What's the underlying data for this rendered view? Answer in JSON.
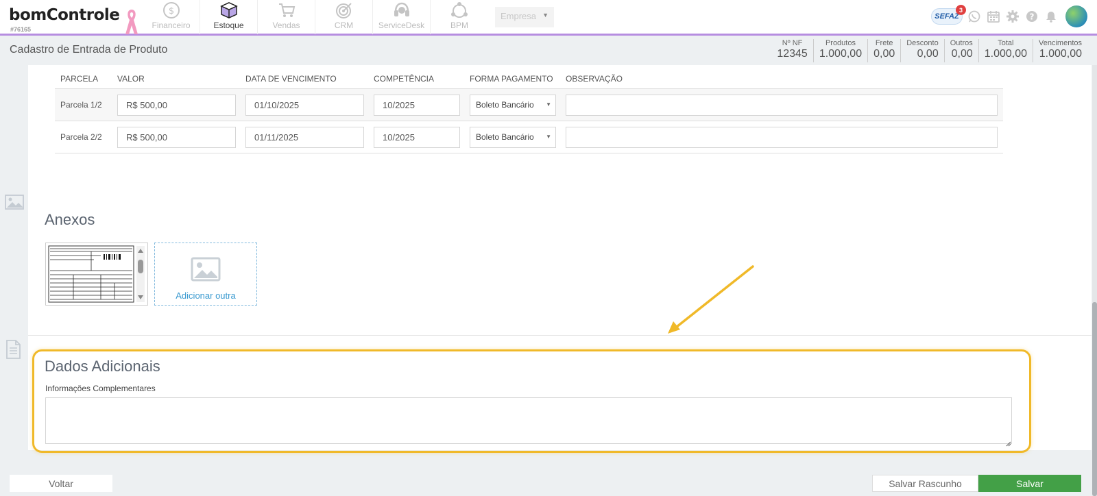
{
  "app": {
    "logo_text": "bomControle",
    "account_id": "#76165"
  },
  "modules": [
    {
      "label": "Financeiro",
      "icon": "dollar-coin-icon",
      "active": false
    },
    {
      "label": "Estoque",
      "icon": "box-icon",
      "active": true
    },
    {
      "label": "Vendas",
      "icon": "shopping-cart-icon",
      "active": false
    },
    {
      "label": "CRM",
      "icon": "target-icon",
      "active": false
    },
    {
      "label": "ServiceDesk",
      "icon": "headset-icon",
      "active": false
    },
    {
      "label": "BPM",
      "icon": "process-cycle-icon",
      "active": false
    }
  ],
  "company_select": {
    "value": "Empresa"
  },
  "header_right": {
    "sefaz_label": "SEFAZ",
    "sefaz_badge": "3"
  },
  "page": {
    "title": "Cadastro de Entrada de Produto"
  },
  "totals": [
    {
      "label": "Nº NF",
      "value": "12345"
    },
    {
      "label": "Produtos",
      "value": "1.000,00"
    },
    {
      "label": "Frete",
      "value": "0,00"
    },
    {
      "label": "Desconto",
      "value": "0,00"
    },
    {
      "label": "Outros",
      "value": "0,00"
    },
    {
      "label": "Total",
      "value": "1.000,00"
    },
    {
      "label": "Vencimentos",
      "value": "1.000,00"
    }
  ],
  "installments": {
    "headers": {
      "parcela": "PARCELA",
      "valor": "VALOR",
      "data": "DATA DE VENCIMENTO",
      "competencia": "COMPETÊNCIA",
      "forma": "FORMA PAGAMENTO",
      "obs": "OBSERVAÇÃO"
    },
    "rows": [
      {
        "parcela": "Parcela 1/2",
        "valor": "R$ 500,00",
        "data": "01/10/2025",
        "competencia": "10/2025",
        "forma": "Boleto Bancário",
        "obs": ""
      },
      {
        "parcela": "Parcela 2/2",
        "valor": "R$ 500,00",
        "data": "01/11/2025",
        "competencia": "10/2025",
        "forma": "Boleto Bancário",
        "obs": ""
      }
    ]
  },
  "attachments": {
    "title": "Anexos",
    "add_label": "Adicionar outra"
  },
  "additional": {
    "title": "Dados Adicionais",
    "info_label": "Informações Complementares",
    "info_value": ""
  },
  "footer": {
    "back": "Voltar",
    "draft": "Salvar Rascunho",
    "save": "Salvar"
  },
  "colors": {
    "accent_purple": "#b68de0",
    "highlight": "#f0b929",
    "save_green": "#43a047",
    "link_blue": "#3a9ad0"
  }
}
